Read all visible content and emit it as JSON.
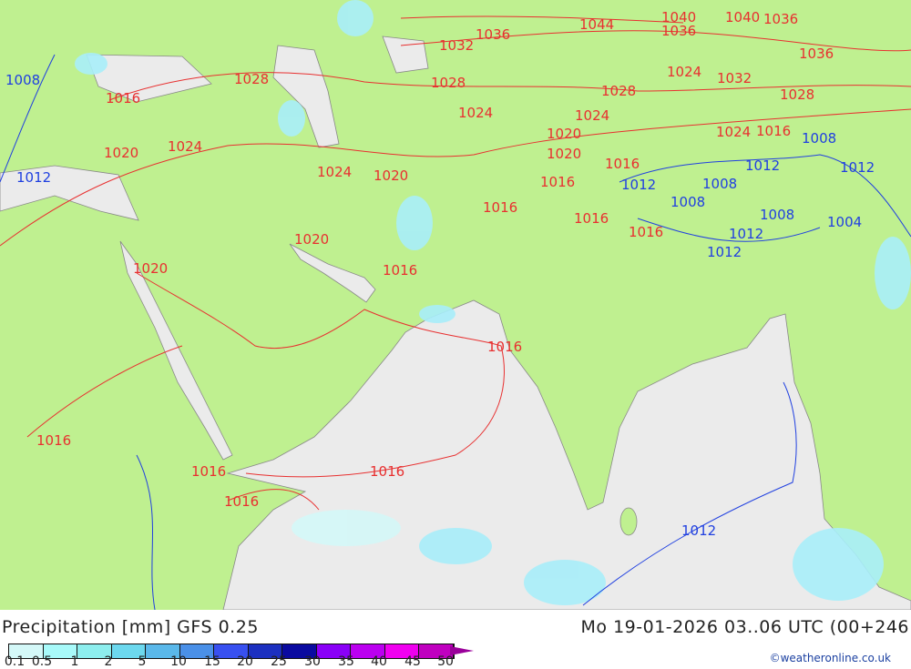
{
  "title": "Precipitation [mm] GFS 0.25",
  "datetime": "Mo 19-01-2026 03..06 UTC (00+246",
  "credit": "©weatheronline.co.uk",
  "legend": {
    "ticks": [
      "0.1",
      "0.5",
      "1",
      "2",
      "5",
      "10",
      "15",
      "20",
      "25",
      "30",
      "35",
      "40",
      "45",
      "50"
    ],
    "colors": [
      "#d4f8f8",
      "#a8fafa",
      "#8deeee",
      "#6cd8ee",
      "#5ab8ea",
      "#4a90e8",
      "#3850f0",
      "#1c30c0",
      "#0a0aa0",
      "#8a00f8",
      "#bb00f0",
      "#f000f0",
      "#c000c0"
    ],
    "arrow_color": "#9a009a"
  },
  "colors": {
    "land": "#bff090",
    "sea": "#ebebeb",
    "isobar_high": "#e83030",
    "isobar_low": "#2040e0",
    "precip": "#a8eefa"
  },
  "isobars": [
    "1044",
    "1040",
    "1036",
    "1036",
    "1032",
    "1036",
    "1040",
    "1036",
    "1032",
    "1028",
    "1028",
    "1028",
    "1024",
    "1028",
    "1024",
    "1016",
    "1020",
    "1024",
    "1024",
    "1020",
    "1020",
    "1024",
    "1020",
    "1016",
    "1016",
    "1016",
    "1020",
    "1016",
    "1016",
    "1016",
    "1016",
    "1016",
    "1016",
    "1016",
    "1024",
    "1016",
    "1016",
    "1020",
    "1012",
    "1008",
    "1012",
    "1012",
    "1008",
    "1008",
    "1008",
    "1012",
    "1004",
    "1012",
    "1008",
    "1012",
    "1012"
  ]
}
